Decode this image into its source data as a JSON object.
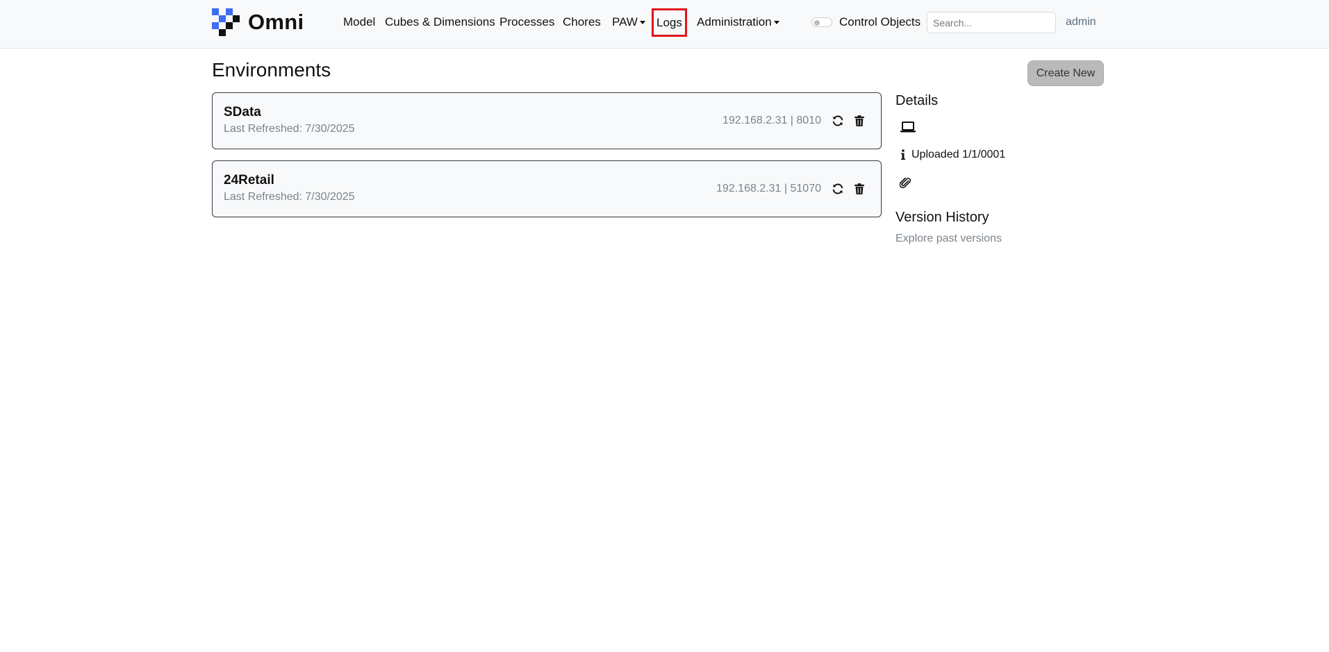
{
  "navbar": {
    "brand": "Omni",
    "items": [
      {
        "label": "Model"
      },
      {
        "label": "Cubes & Dimensions"
      },
      {
        "label": "Processes"
      },
      {
        "label": "Chores"
      },
      {
        "label": "PAW"
      },
      {
        "label": "Logs"
      },
      {
        "label": "Administration"
      }
    ],
    "control_objects_label": "Control Objects",
    "search_placeholder": "Search...",
    "user": "admin"
  },
  "main": {
    "title": "Environments",
    "create_button": "Create New",
    "environments": [
      {
        "name": "SData",
        "last_refreshed": "Last Refreshed: 7/30/2025",
        "host": "192.168.2.31 | 8010"
      },
      {
        "name": "24Retail",
        "last_refreshed": "Last Refreshed: 7/30/2025",
        "host": "192.168.2.31 | 51070"
      }
    ]
  },
  "details": {
    "heading": "Details",
    "uploaded": "Uploaded 1/1/0001",
    "version_heading": "Version History",
    "version_sub": "Explore past versions",
    "icons": [
      "laptop-icon",
      "info-icon",
      "paperclip-icon"
    ]
  },
  "colors": {
    "logo_blue": "#3f6cf5",
    "logo_black": "#111111",
    "highlight": "#e0141b",
    "muted_text": "#7b838b",
    "button_bg": "#b9babb"
  }
}
